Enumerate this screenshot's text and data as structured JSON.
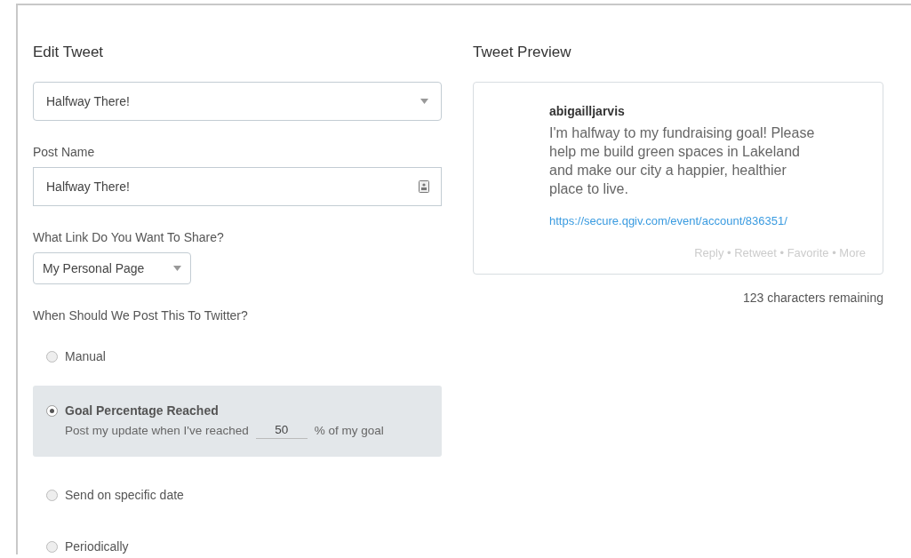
{
  "editor": {
    "title": "Edit Tweet",
    "template_select": {
      "value": "Halfway There!"
    },
    "post_name": {
      "label": "Post Name",
      "value": "Halfway There!"
    },
    "link": {
      "label": "What Link Do You Want To Share?",
      "value": "My Personal Page"
    },
    "schedule": {
      "label": "When Should We Post This To Twitter?",
      "options": [
        {
          "kind": "simple",
          "label": "Manual",
          "selected": false
        },
        {
          "kind": "goal",
          "label": "Goal Percentage Reached",
          "selected": true,
          "text_before": "Post my update when I've reached",
          "value": "50",
          "text_after": "% of my goal"
        },
        {
          "kind": "simple",
          "label": "Send on specific date",
          "selected": false
        },
        {
          "kind": "simple",
          "label": "Periodically",
          "selected": false
        }
      ]
    }
  },
  "preview": {
    "title": "Tweet Preview",
    "username": "abigailljarvis",
    "text": "I'm halfway to my fundraising goal! Please help me build green spaces in Lakeland and make our city a happier, healthier place to live.",
    "link": "https://secure.qgiv.com/event/account/836351/",
    "actions": "Reply • Retweet • Favorite • More",
    "remaining": "123 characters remaining"
  }
}
